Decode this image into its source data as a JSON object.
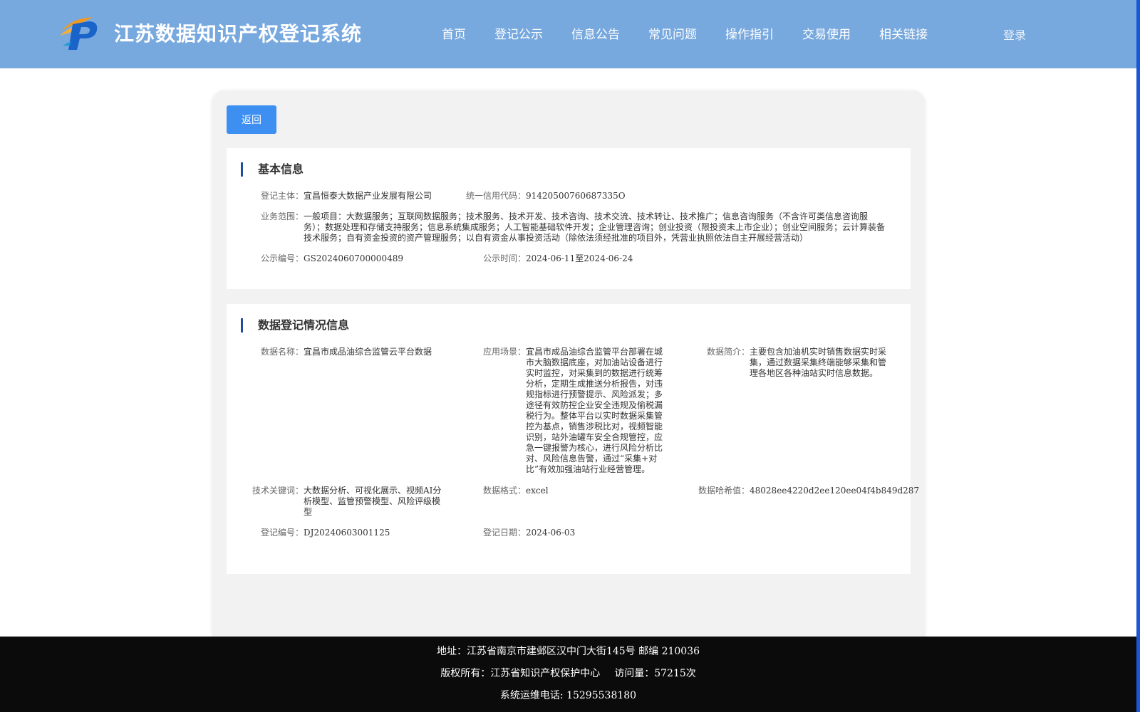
{
  "header": {
    "site_title": "江苏数据知识产权登记系统",
    "logo_icon": "ip-logo-icon",
    "nav": [
      "首页",
      "登记公示",
      "信息公告",
      "常见问题",
      "操作指引",
      "交易使用",
      "相关链接"
    ],
    "login": "登录"
  },
  "back_button": "返回",
  "basic_info": {
    "title": "基本信息",
    "subject_label": "登记主体：",
    "subject_value": "宜昌恒泰大数据产业发展有限公司",
    "credit_label": "统一信用代码：",
    "credit_value": "91420500760687335O",
    "scope_label": "业务范围：",
    "scope_value": "一般项目：大数据服务；互联网数据服务；技术服务、技术开发、技术咨询、技术交流、技术转让、技术推广；信息咨询服务（不含许可类信息咨询服务）；数据处理和存储支持服务；信息系统集成服务；人工智能基础软件开发；企业管理咨询；创业投资（限投资未上市企业）；创业空间服务；云计算装备技术服务；自有资金投资的资产管理服务；以自有资金从事投资活动（除依法须经批准的项目外，凭营业执照依法自主开展经营活动）",
    "notice_no_label": "公示编号：",
    "notice_no_value": "GS2024060700000489",
    "notice_time_label": "公示时间：",
    "notice_time_value": "2024-06-11至2024-06-24"
  },
  "registration_info": {
    "title": "数据登记情况信息",
    "name_label": "数据名称：",
    "name_value": "宜昌市成品油综合监管云平台数据",
    "scene_label": "应用场景：",
    "scene_value": "宜昌市成品油综合监管平台部署在城市大脑数据底座，对加油站设备进行实时监控，对采集到的数据进行统筹分析，定期生成推送分析报告，对违规指标进行预警提示、风险派发；多途径有效防控企业安全违规及偷税漏税行为。整体平台以实时数据采集管控为基点，销售涉税比对，视频智能识别，站外油罐车安全合规管控，应急一键报警为核心，进行风险分析比对、风险信息告警，通过“采集+对比”有效加强油站行业经营管理。",
    "intro_label": "数据简介：",
    "intro_value": "主要包含加油机实时销售数据实时采集，通过数据采集终端能够采集和管理各地区各种油站实时信息数据。",
    "keywords_label": "技术关键词：",
    "keywords_value": "大数据分析、可视化展示、视频AI分析模型、监管预警模型、风险评级模型",
    "format_label": "数据格式：",
    "format_value": "excel",
    "hash_label": "数据哈希值：",
    "hash_value": "48028ee4220d2ee120ee04f4b849d287",
    "reg_no_label": "登记编号：",
    "reg_no_value": "DJ20240603001125",
    "reg_date_label": "登记日期：",
    "reg_date_value": "2024-06-03"
  },
  "footer": {
    "address": "地址：江苏省南京市建邺区汉中门大街145号 邮编 210036",
    "copyright": "版权所有：江苏省知识产权保护中心",
    "visits": "访问量：57215次",
    "phone": "系统运维电话: 15295538180"
  },
  "colors": {
    "header_bg": "#77a8de",
    "button": "#3d8ff2",
    "title_accent": "#1e4f9e",
    "footer_bg": "#0b0b0b"
  }
}
